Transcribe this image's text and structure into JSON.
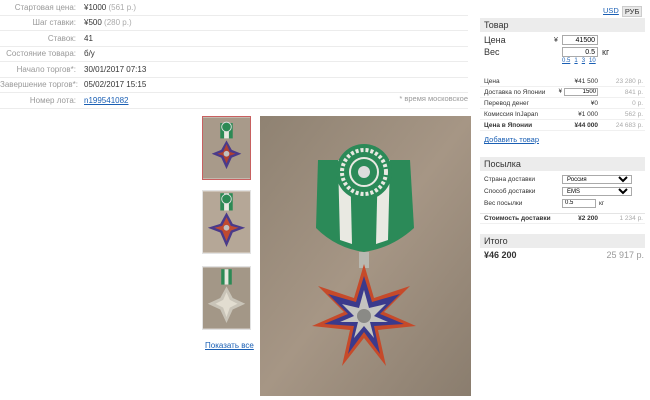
{
  "lot": {
    "rows": [
      {
        "label": "Стартовая цена:",
        "value": "¥1000",
        "sub": "(561 р.)"
      },
      {
        "label": "Шаг ставки:",
        "value": "¥500",
        "sub": "(280 р.)"
      },
      {
        "label": "Ставок:",
        "value": "41",
        "sub": ""
      },
      {
        "label": "Состояние товара:",
        "value": "б/у",
        "sub": ""
      },
      {
        "label": "Начало торгов*:",
        "value": "30/01/2017 07:13",
        "sub": ""
      },
      {
        "label": "Завершение торгов*:",
        "value": "05/02/2017 15:15",
        "sub": ""
      },
      {
        "label": "Номер лота:",
        "value": "n199541082",
        "sub": ""
      }
    ],
    "tz_note": "* время московское"
  },
  "gallery": {
    "show_all": "Показать все"
  },
  "currency": {
    "usd": "USD",
    "rub": "РУБ"
  },
  "product": {
    "header": "Товар",
    "price_label": "Цена",
    "price_prefix": "¥",
    "price_value": "41500",
    "weight_label": "Вес",
    "weight_value": "0.5",
    "weight_unit": "кг",
    "weight_steps": [
      "0.5",
      "1",
      "3",
      "10"
    ],
    "rows": [
      {
        "name": "Цена",
        "yen": "¥41 500",
        "rub": "23 280 р."
      },
      {
        "name": "Доставка по Японии",
        "yen": "1500",
        "rub": "841 р."
      },
      {
        "name": "Перевод денег",
        "yen": "¥0",
        "rub": "0 р."
      },
      {
        "name": "Комиссия InJapan",
        "yen": "¥1 000",
        "rub": "562 р."
      }
    ],
    "japan_price": {
      "name": "Цена в Японии",
      "yen": "¥44 000",
      "rub": "24 683 р."
    },
    "add_link": "Добавить товар"
  },
  "parcel": {
    "header": "Посылка",
    "country_label": "Страна доставки",
    "country_value": "Россия",
    "method_label": "Способ доставки",
    "method_value": "EMS",
    "weight_label": "Вес посылки",
    "weight_value": "0.5",
    "weight_unit": "кг",
    "shipping": {
      "name": "Стоимость доставки",
      "yen": "¥2 200",
      "rub": "1 234 р."
    }
  },
  "total": {
    "header": "Итого",
    "yen": "¥46 200",
    "rub": "25 917 р."
  }
}
